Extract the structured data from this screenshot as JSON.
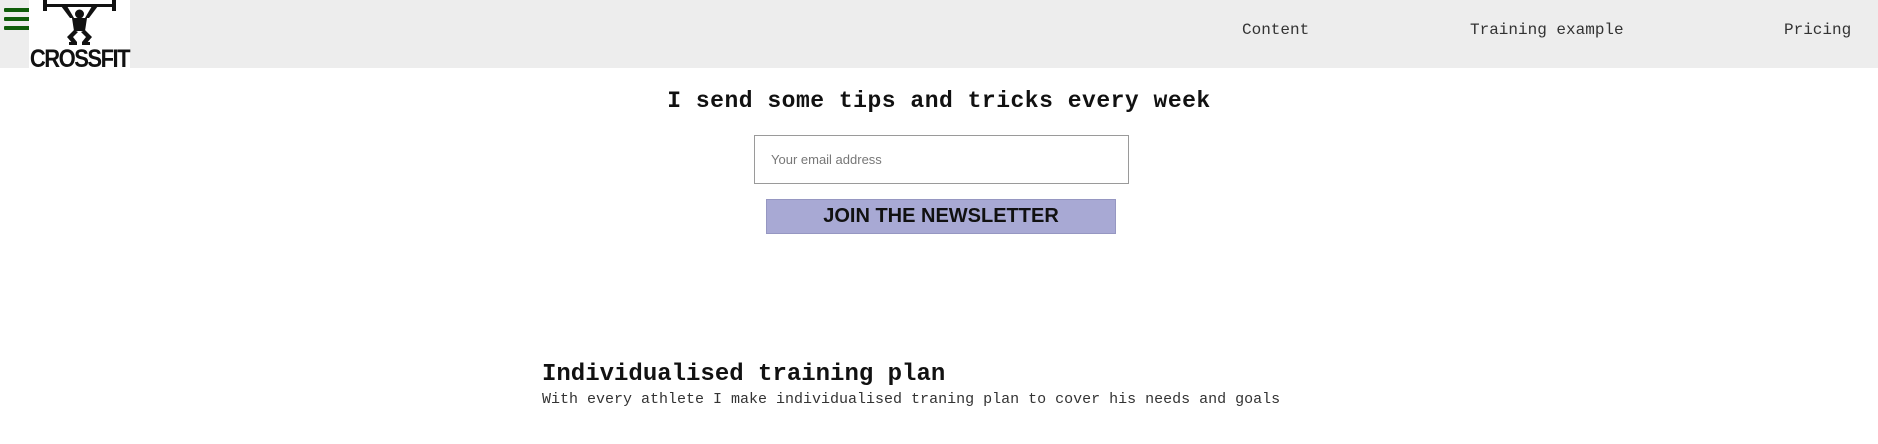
{
  "header": {
    "menu_icon": "hamburger-menu-icon",
    "logo": {
      "text": "CROSSFIT",
      "icon": "weightlifter-icon"
    },
    "nav": [
      {
        "label": "Content"
      },
      {
        "label": "Training example"
      },
      {
        "label": "Pricing"
      }
    ]
  },
  "newsletter": {
    "headline": "I send some tips and tricks every week",
    "email_placeholder": "Your email address",
    "email_value": "",
    "button_label": "JOIN THE NEWSLETTER",
    "button_color": "#a8a9d4"
  },
  "feature": {
    "title": "Individualised training plan",
    "description": "With every athlete I make individualised traning plan to cover his needs and goals"
  },
  "colors": {
    "topbar_background": "#ededed",
    "menu_icon": "#0f5d0a"
  }
}
